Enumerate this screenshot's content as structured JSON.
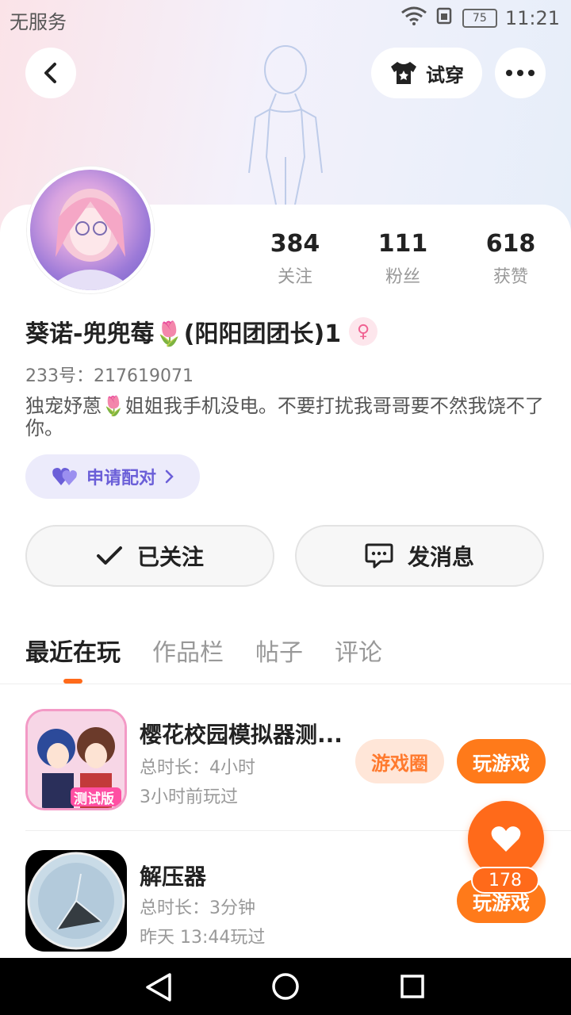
{
  "status": {
    "carrier": "无服务",
    "battery": "75",
    "time": "11:21"
  },
  "header": {
    "try_on_label": "试穿"
  },
  "stats": [
    {
      "value": "384",
      "label": "关注"
    },
    {
      "value": "111",
      "label": "粉丝"
    },
    {
      "value": "618",
      "label": "获赞"
    }
  ],
  "profile": {
    "name": "葵诺-兜兜莓🌷(阳阳团团长)1",
    "uid": "233号：217619071",
    "bio": "独宠妤蒽🌷姐姐我手机没电。不要打扰我哥哥要不然我饶不了你。",
    "pair_label": "申请配对"
  },
  "actions": {
    "followed_label": "已关注",
    "message_label": "发消息"
  },
  "tabs": [
    "最近在玩",
    "作品栏",
    "帖子",
    "评论"
  ],
  "games": [
    {
      "title": "樱花校园模拟器测...",
      "duration": "总时长：4小时",
      "last_played": "3小时前玩过",
      "circle_label": "游戏圈",
      "play_label": "玩游戏",
      "badge": "测试版"
    },
    {
      "title": "解压器",
      "duration": "总时长：3分钟",
      "last_played": "昨天 13:44玩过",
      "play_label": "玩游戏"
    }
  ],
  "like": {
    "count": "178"
  },
  "colors": {
    "accent": "#ff6a1a",
    "pair": "#6b5fd8"
  }
}
